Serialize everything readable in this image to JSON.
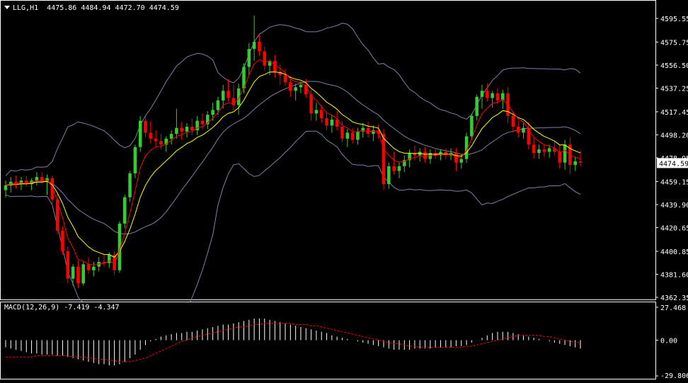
{
  "header": {
    "symbol": "LLG,H1",
    "open": "4475.86",
    "high": "4484.94",
    "low": "4472.70",
    "close": "4474.59"
  },
  "price_axis": {
    "ticks": [
      "4595.55",
      "4575.75",
      "4556.50",
      "4537.25",
      "4517.45",
      "4498.20",
      "4478.95",
      "4459.15",
      "4439.90",
      "4420.65",
      "4400.85",
      "4381.60",
      "4362.35"
    ],
    "current_price": "4474.59"
  },
  "macd": {
    "label": "MACD(12,26,9) -7.419 -4.347",
    "ticks": [
      "27.468",
      "0.00",
      "-29.806"
    ]
  },
  "colors": {
    "bull": "#32cd32",
    "bear": "#ff0000",
    "ma_fast": "#ff0000",
    "ma_slow": "#ffff00",
    "bands": "#7f7fa8",
    "signal": "#ff0000",
    "histogram": "#ffffff"
  },
  "chart_data": [
    {
      "type": "candlestick",
      "series_name": "LLG,H1",
      "ylim": [
        4362.35,
        4605
      ],
      "indicators": [
        "Bollinger Bands",
        "Moving Average (fast)",
        "Moving Average (slow)"
      ],
      "grid": false,
      "candles": [
        [
          4452,
          4460,
          4446,
          4456
        ],
        [
          4456,
          4463,
          4450,
          4459
        ],
        [
          4459,
          4464,
          4453,
          4457
        ],
        [
          4457,
          4463,
          4452,
          4460
        ],
        [
          4460,
          4464,
          4455,
          4457
        ],
        [
          4457,
          4462,
          4452,
          4460
        ],
        [
          4460,
          4467,
          4456,
          4463
        ],
        [
          4463,
          4467,
          4457,
          4459
        ],
        [
          4459,
          4465,
          4448,
          4462
        ],
        [
          4462,
          4464,
          4440,
          4444
        ],
        [
          4444,
          4449,
          4415,
          4418
        ],
        [
          4418,
          4422,
          4398,
          4401
        ],
        [
          4401,
          4405,
          4374,
          4378
        ],
        [
          4378,
          4390,
          4372,
          4388
        ],
        [
          4388,
          4393,
          4370,
          4374
        ],
        [
          4374,
          4392,
          4372,
          4390
        ],
        [
          4390,
          4396,
          4382,
          4385
        ],
        [
          4385,
          4392,
          4380,
          4388
        ],
        [
          4388,
          4396,
          4384,
          4392
        ],
        [
          4392,
          4398,
          4388,
          4391
        ],
        [
          4391,
          4400,
          4387,
          4398
        ],
        [
          4398,
          4401,
          4381,
          4385
        ],
        [
          4385,
          4426,
          4383,
          4424
        ],
        [
          4424,
          4448,
          4420,
          4446
        ],
        [
          4446,
          4468,
          4442,
          4466
        ],
        [
          4466,
          4490,
          4462,
          4488
        ],
        [
          4488,
          4514,
          4484,
          4510
        ],
        [
          4510,
          4514,
          4496,
          4500
        ],
        [
          4500,
          4510,
          4491,
          4495
        ],
        [
          4495,
          4502,
          4488,
          4493
        ],
        [
          4493,
          4499,
          4486,
          4490
        ],
        [
          4490,
          4497,
          4484,
          4495
        ],
        [
          4495,
          4502,
          4490,
          4499
        ],
        [
          4499,
          4520,
          4495,
          4504
        ],
        [
          4504,
          4509,
          4494,
          4501
        ],
        [
          4501,
          4508,
          4496,
          4505
        ],
        [
          4505,
          4512,
          4498,
          4502
        ],
        [
          4502,
          4514,
          4498,
          4510
        ],
        [
          4510,
          4516,
          4503,
          4507
        ],
        [
          4507,
          4518,
          4503,
          4515
        ],
        [
          4515,
          4525,
          4510,
          4519
        ],
        [
          4519,
          4530,
          4515,
          4527
        ],
        [
          4527,
          4540,
          4520,
          4535
        ],
        [
          4535,
          4545,
          4526,
          4529
        ],
        [
          4529,
          4540,
          4519,
          4523
        ],
        [
          4523,
          4541,
          4515,
          4537
        ],
        [
          4537,
          4558,
          4533,
          4555
        ],
        [
          4555,
          4575,
          4548,
          4570
        ],
        [
          4570,
          4598,
          4560,
          4576
        ],
        [
          4576,
          4582,
          4564,
          4568
        ],
        [
          4568,
          4572,
          4552,
          4556
        ],
        [
          4556,
          4561,
          4548,
          4560
        ],
        [
          4560,
          4565,
          4546,
          4551
        ],
        [
          4551,
          4557,
          4540,
          4548
        ],
        [
          4548,
          4553,
          4539,
          4542
        ],
        [
          4542,
          4547,
          4530,
          4535
        ],
        [
          4535,
          4541,
          4527,
          4538
        ],
        [
          4538,
          4543,
          4533,
          4540
        ],
        [
          4540,
          4545,
          4529,
          4532
        ],
        [
          4532,
          4536,
          4510,
          4516
        ],
        [
          4516,
          4525,
          4510,
          4519
        ],
        [
          4519,
          4523,
          4508,
          4512
        ],
        [
          4512,
          4517,
          4502,
          4506
        ],
        [
          4506,
          4515,
          4500,
          4511
        ],
        [
          4511,
          4518,
          4502,
          4505
        ],
        [
          4505,
          4510,
          4492,
          4495
        ],
        [
          4495,
          4503,
          4488,
          4500
        ],
        [
          4500,
          4504,
          4491,
          4494
        ],
        [
          4494,
          4504,
          4490,
          4501
        ],
        [
          4501,
          4508,
          4496,
          4504
        ],
        [
          4504,
          4509,
          4496,
          4499
        ],
        [
          4499,
          4506,
          4493,
          4502
        ],
        [
          4502,
          4507,
          4495,
          4499
        ],
        [
          4499,
          4503,
          4452,
          4457
        ],
        [
          4457,
          4475,
          4453,
          4472
        ],
        [
          4472,
          4484,
          4465,
          4468
        ],
        [
          4468,
          4475,
          4462,
          4472
        ],
        [
          4472,
          4481,
          4467,
          4477
        ],
        [
          4477,
          4486,
          4471,
          4483
        ],
        [
          4483,
          4489,
          4477,
          4481
        ],
        [
          4481,
          4487,
          4476,
          4484
        ],
        [
          4484,
          4488,
          4475,
          4478
        ],
        [
          4478,
          4486,
          4474,
          4483
        ],
        [
          4483,
          4487,
          4478,
          4481
        ],
        [
          4481,
          4486,
          4477,
          4484
        ],
        [
          4484,
          4487,
          4478,
          4481
        ],
        [
          4481,
          4487,
          4477,
          4483
        ],
        [
          4483,
          4487,
          4468,
          4475
        ],
        [
          4475,
          4482,
          4470,
          4478
        ],
        [
          4478,
          4500,
          4475,
          4497
        ],
        [
          4497,
          4516,
          4494,
          4514
        ],
        [
          4514,
          4532,
          4510,
          4530
        ],
        [
          4530,
          4540,
          4520,
          4535
        ],
        [
          4535,
          4541,
          4526,
          4529
        ],
        [
          4529,
          4535,
          4521,
          4533
        ],
        [
          4533,
          4537,
          4524,
          4527
        ],
        [
          4527,
          4536,
          4520,
          4533
        ],
        [
          4533,
          4538,
          4508,
          4514
        ],
        [
          4514,
          4517,
          4500,
          4505
        ],
        [
          4505,
          4510,
          4496,
          4500
        ],
        [
          4500,
          4508,
          4495,
          4504
        ],
        [
          4504,
          4509,
          4486,
          4490
        ],
        [
          4490,
          4496,
          4478,
          4483
        ],
        [
          4483,
          4490,
          4478,
          4486
        ],
        [
          4486,
          4490,
          4480,
          4484
        ],
        [
          4484,
          4490,
          4479,
          4487
        ],
        [
          4487,
          4493,
          4481,
          4484
        ],
        [
          4484,
          4490,
          4470,
          4475
        ],
        [
          4475,
          4494,
          4469,
          4490
        ],
        [
          4490,
          4496,
          4465,
          4473
        ],
        [
          4473,
          4480,
          4468,
          4476
        ],
        [
          4476,
          4485,
          4472,
          4475
        ]
      ]
    },
    {
      "type": "bar",
      "series_name": "MACD(12,26,9)",
      "ylim": [
        -29.806,
        27.468
      ],
      "values": [
        -6,
        -7,
        -8,
        -9,
        -10,
        -11,
        -11,
        -12,
        -12,
        -12,
        -13,
        -13,
        -14,
        -15,
        -16,
        -17,
        -18,
        -19,
        -20,
        -20,
        -21,
        -21,
        -20,
        -18,
        -15,
        -12,
        -8,
        -4,
        -1,
        1,
        3,
        4,
        5,
        6,
        6,
        7,
        7,
        8,
        9,
        10,
        11,
        12,
        13,
        13,
        14,
        15,
        16,
        17,
        18,
        18,
        18,
        17,
        16,
        15,
        14,
        13,
        12,
        11,
        10,
        9,
        8,
        7,
        6,
        4,
        3,
        2,
        1,
        0,
        -1,
        -2,
        -3,
        -4,
        -5,
        -6,
        -7,
        -8,
        -8,
        -8,
        -8,
        -7,
        -7,
        -7,
        -7,
        -6,
        -6,
        -6,
        -6,
        -5,
        -5,
        -4,
        -2,
        0,
        2,
        4,
        6,
        7,
        7,
        7,
        6,
        5,
        4,
        3,
        2,
        1,
        0,
        -1,
        -2,
        -3,
        -4,
        -5,
        -6,
        -7
      ]
    },
    {
      "type": "line",
      "series_name": "MACD signal",
      "ylim": [
        -29.806,
        27.468
      ],
      "values": [
        -14,
        -14,
        -14,
        -14,
        -14,
        -14,
        -13,
        -13,
        -13,
        -13,
        -13,
        -13,
        -13,
        -14,
        -14,
        -14,
        -15,
        -15,
        -16,
        -16,
        -17,
        -17,
        -18,
        -18,
        -18,
        -17,
        -16,
        -15,
        -13,
        -11,
        -9,
        -7,
        -5,
        -3,
        -1,
        0,
        2,
        3,
        4,
        5,
        6,
        7,
        8,
        9,
        10,
        11,
        11,
        12,
        13,
        13,
        14,
        14,
        14,
        14,
        14,
        14,
        13,
        13,
        13,
        12,
        12,
        11,
        10,
        9,
        8,
        7,
        6,
        5,
        4,
        3,
        2,
        1,
        0,
        -1,
        -2,
        -3,
        -3,
        -4,
        -5,
        -5,
        -6,
        -6,
        -6,
        -6,
        -6,
        -6,
        -6,
        -6,
        -6,
        -5,
        -5,
        -4,
        -3,
        -2,
        -1,
        0,
        1,
        2,
        3,
        4,
        4,
        4,
        4,
        4,
        3,
        3,
        2,
        1,
        0,
        -1,
        -2,
        -2
      ]
    }
  ]
}
